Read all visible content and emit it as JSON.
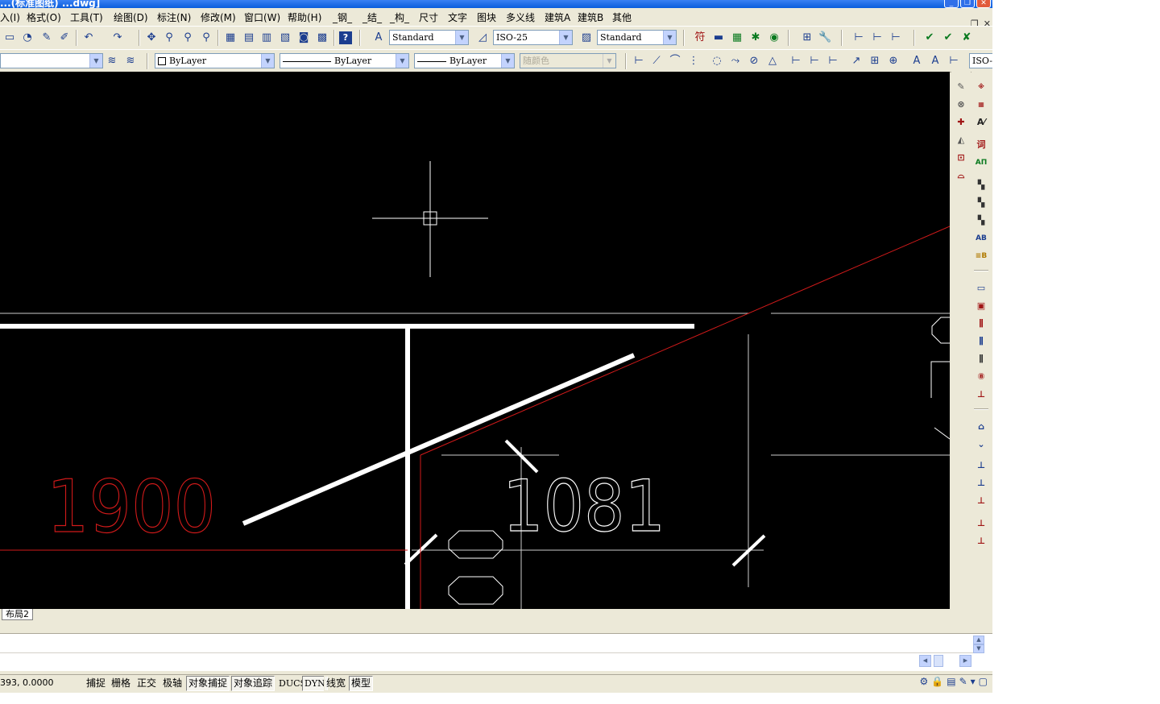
{
  "title": "...(标准图纸) ...dwg]",
  "window_buttons": {
    "minimize": "_",
    "restore": "❐",
    "close": "✕"
  },
  "doc_buttons": {
    "minimize": "_",
    "restore": "❐",
    "close": "✕"
  },
  "menu": [
    "入(I)",
    "格式(O)",
    "工具(T)",
    "绘图(D)",
    "标注(N)",
    "修改(M)",
    "窗口(W)",
    "帮助(H)",
    "_钢_",
    "_结_",
    "_构_",
    "尺寸",
    "文字",
    "图块",
    "多义线",
    "建筑A",
    "建筑B",
    "其他"
  ],
  "toolbar_row1": {
    "text_style": "Standard",
    "dim_style": "ISO-25",
    "table_style": "Standard"
  },
  "toolbar_row2": {
    "layer": "",
    "color": "ByLayer",
    "linetype": "ByLayer",
    "lineweight": "ByLayer",
    "plot_style": "随颜色",
    "dim_style_short": "ISO-"
  },
  "drawing": {
    "label_left": "1900",
    "label_right": "1081",
    "colors": {
      "background": "#000000",
      "white": "#ffffff",
      "red": "#d11a1a",
      "grey": "#cccccc"
    }
  },
  "layout_tab": "布局2",
  "status": {
    "coords": "393, 0.0000",
    "buttons": [
      "捕捉",
      "栅格",
      "正交",
      "极轴",
      "对象捕捉",
      "对象追踪",
      "DUCS",
      "DYN",
      "线宽",
      "模型"
    ]
  },
  "icons": {
    "toolbar1": [
      "new-icon",
      "open-icon",
      "pencil-icon",
      "brush-icon",
      "undo-icon",
      "redo-icon",
      "pan-icon",
      "zoom-realtime-icon",
      "zoom-window-icon",
      "zoom-previous-icon",
      "properties-icon",
      "design-center-icon",
      "tool-palette-icon",
      "sheet-set-icon",
      "markup-icon",
      "calculator-icon",
      "help-icon",
      "text-style-icon",
      "dim-style-icon",
      "table-style-icon"
    ],
    "right_tool_a": [
      "erase-icon",
      "copy-icon",
      "move-icon",
      "mirror-icon",
      "offset-icon",
      "array-icon"
    ],
    "right_tool_b": [
      "hatch-icon",
      "grid-icon",
      "text-icon",
      "word-icon",
      "ab-text-icon",
      "stair-icon",
      "elevator-icon",
      "beam-icon",
      "ab-icon",
      "layer-list-icon",
      "window-icon",
      "door-icon",
      "column-icon",
      "axis-icon",
      "axis2-icon",
      "number-icon",
      "dim-vertical-icon",
      "up-arrow-icon",
      "down-arrow-icon",
      "elev-icon",
      "elev2-icon",
      "dim-icon",
      "dim2-icon",
      "dim3-icon"
    ]
  }
}
